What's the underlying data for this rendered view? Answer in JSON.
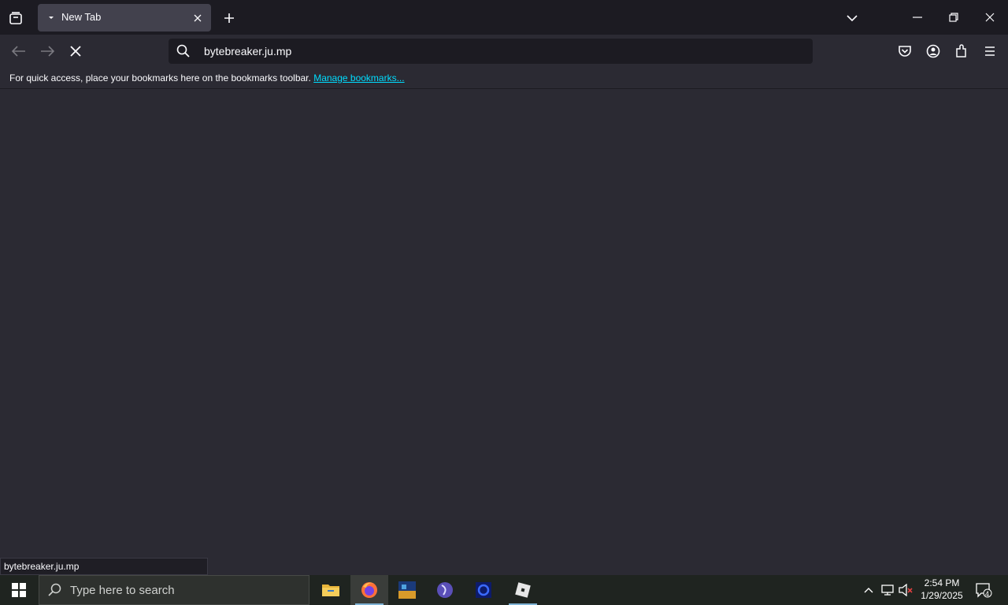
{
  "browser": {
    "tabs": [
      {
        "title": "New Tab"
      }
    ],
    "url": "bytebreaker.ju.mp",
    "bookmarks_message": "For quick access, place your bookmarks here on the bookmarks toolbar.",
    "bookmarks_link": "Manage bookmarks...",
    "status_text": "bytebreaker.ju.mp"
  },
  "taskbar": {
    "search_placeholder": "Type here to search",
    "time": "2:54 PM",
    "date": "1/29/2025",
    "notification_count": "4"
  },
  "colors": {
    "tab_strip": "#1c1b22",
    "toolbar": "#2b2a33",
    "link": "#00ddff",
    "taskbar": "#1f2420"
  }
}
